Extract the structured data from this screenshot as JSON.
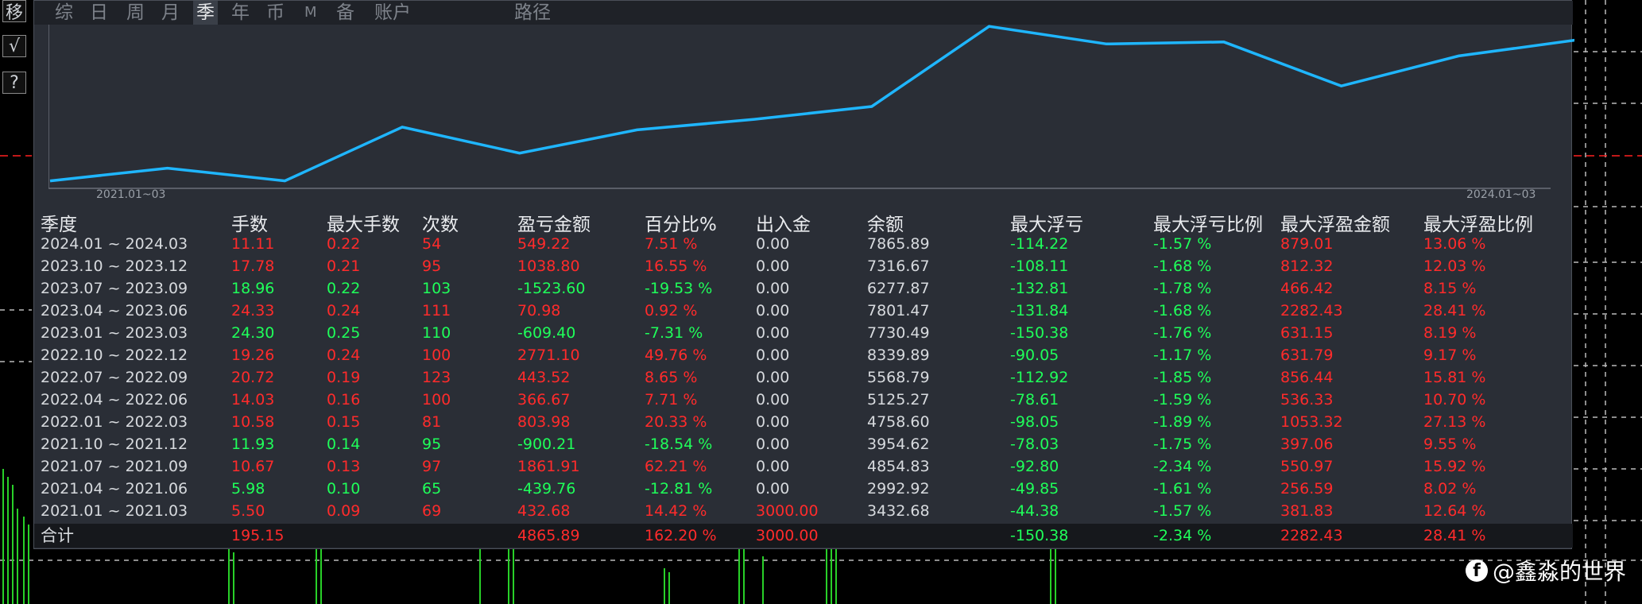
{
  "side_buttons": [
    "移",
    "√",
    "?"
  ],
  "tabs": [
    {
      "label": "综",
      "active": false
    },
    {
      "label": "日",
      "active": false
    },
    {
      "label": "周",
      "active": false
    },
    {
      "label": "月",
      "active": false
    },
    {
      "label": "季",
      "active": true
    },
    {
      "label": "年",
      "active": false
    },
    {
      "label": "币",
      "active": false
    },
    {
      "label": "M",
      "active": false
    },
    {
      "label": "备",
      "active": false
    },
    {
      "label": "账户",
      "active": false
    },
    {
      "label": "路径",
      "active": false
    }
  ],
  "equity_chart": {
    "start_label": "2021.01~03",
    "end_label": "2024.01~03",
    "color": "#1fb6ff",
    "balances": [
      2992.92,
      3432.68,
      2992.92,
      4854.83,
      3954.62,
      4758.6,
      5125.27,
      5568.79,
      8339.89,
      7730.49,
      7801.47,
      6277.87,
      7316.67,
      7865.89
    ]
  },
  "headers": [
    "季度",
    "手数",
    "最大手数",
    "次数",
    "盈亏金额",
    "百分比%",
    "出入金",
    "余额",
    "最大浮亏",
    "最大浮亏比例",
    "最大浮盈金额",
    "最大浮盈比例"
  ],
  "rows": [
    {
      "period": "2024.01 ~ 2024.03",
      "lots": "11.11",
      "max_lots": "0.22",
      "count": "54",
      "pnl": "549.22",
      "pct": "7.51 %",
      "flow": "0.00",
      "balance": "7865.89",
      "max_dd": "-114.22",
      "max_dd_pct": "-1.57 %",
      "max_float": "879.01",
      "max_float_pct": "13.06 %",
      "positive": true
    },
    {
      "period": "2023.10 ~ 2023.12",
      "lots": "17.78",
      "max_lots": "0.21",
      "count": "95",
      "pnl": "1038.80",
      "pct": "16.55 %",
      "flow": "0.00",
      "balance": "7316.67",
      "max_dd": "-108.11",
      "max_dd_pct": "-1.68 %",
      "max_float": "812.32",
      "max_float_pct": "12.03 %",
      "positive": true
    },
    {
      "period": "2023.07 ~ 2023.09",
      "lots": "18.96",
      "max_lots": "0.22",
      "count": "103",
      "pnl": "-1523.60",
      "pct": "-19.53 %",
      "flow": "0.00",
      "balance": "6277.87",
      "max_dd": "-132.81",
      "max_dd_pct": "-1.78 %",
      "max_float": "466.42",
      "max_float_pct": "8.15 %",
      "positive": false
    },
    {
      "period": "2023.04 ~ 2023.06",
      "lots": "24.33",
      "max_lots": "0.24",
      "count": "111",
      "pnl": "70.98",
      "pct": "0.92 %",
      "flow": "0.00",
      "balance": "7801.47",
      "max_dd": "-131.84",
      "max_dd_pct": "-1.68 %",
      "max_float": "2282.43",
      "max_float_pct": "28.41 %",
      "positive": true
    },
    {
      "period": "2023.01 ~ 2023.03",
      "lots": "24.30",
      "max_lots": "0.25",
      "count": "110",
      "pnl": "-609.40",
      "pct": "-7.31 %",
      "flow": "0.00",
      "balance": "7730.49",
      "max_dd": "-150.38",
      "max_dd_pct": "-1.76 %",
      "max_float": "631.15",
      "max_float_pct": "8.19 %",
      "positive": false
    },
    {
      "period": "2022.10 ~ 2022.12",
      "lots": "19.26",
      "max_lots": "0.24",
      "count": "100",
      "pnl": "2771.10",
      "pct": "49.76 %",
      "flow": "0.00",
      "balance": "8339.89",
      "max_dd": "-90.05",
      "max_dd_pct": "-1.17 %",
      "max_float": "631.79",
      "max_float_pct": "9.17 %",
      "positive": true
    },
    {
      "period": "2022.07 ~ 2022.09",
      "lots": "20.72",
      "max_lots": "0.19",
      "count": "123",
      "pnl": "443.52",
      "pct": "8.65 %",
      "flow": "0.00",
      "balance": "5568.79",
      "max_dd": "-112.92",
      "max_dd_pct": "-1.85 %",
      "max_float": "856.44",
      "max_float_pct": "15.81 %",
      "positive": true
    },
    {
      "period": "2022.04 ~ 2022.06",
      "lots": "14.03",
      "max_lots": "0.16",
      "count": "100",
      "pnl": "366.67",
      "pct": "7.71 %",
      "flow": "0.00",
      "balance": "5125.27",
      "max_dd": "-78.61",
      "max_dd_pct": "-1.59 %",
      "max_float": "536.33",
      "max_float_pct": "10.70 %",
      "positive": true
    },
    {
      "period": "2022.01 ~ 2022.03",
      "lots": "10.58",
      "max_lots": "0.15",
      "count": "81",
      "pnl": "803.98",
      "pct": "20.33 %",
      "flow": "0.00",
      "balance": "4758.60",
      "max_dd": "-98.05",
      "max_dd_pct": "-1.89 %",
      "max_float": "1053.32",
      "max_float_pct": "27.13 %",
      "positive": true
    },
    {
      "period": "2021.10 ~ 2021.12",
      "lots": "11.93",
      "max_lots": "0.14",
      "count": "95",
      "pnl": "-900.21",
      "pct": "-18.54 %",
      "flow": "0.00",
      "balance": "3954.62",
      "max_dd": "-78.03",
      "max_dd_pct": "-1.75 %",
      "max_float": "397.06",
      "max_float_pct": "9.55 %",
      "positive": false
    },
    {
      "period": "2021.07 ~ 2021.09",
      "lots": "10.67",
      "max_lots": "0.13",
      "count": "97",
      "pnl": "1861.91",
      "pct": "62.21 %",
      "flow": "0.00",
      "balance": "4854.83",
      "max_dd": "-92.80",
      "max_dd_pct": "-2.34 %",
      "max_float": "550.97",
      "max_float_pct": "15.92 %",
      "positive": true
    },
    {
      "period": "2021.04 ~ 2021.06",
      "lots": "5.98",
      "max_lots": "0.10",
      "count": "65",
      "pnl": "-439.76",
      "pct": "-12.81 %",
      "flow": "0.00",
      "balance": "2992.92",
      "max_dd": "-49.85",
      "max_dd_pct": "-1.61 %",
      "max_float": "256.59",
      "max_float_pct": "8.02 %",
      "positive": false
    },
    {
      "period": "2021.01 ~ 2021.03",
      "lots": "5.50",
      "max_lots": "0.09",
      "count": "69",
      "pnl": "432.68",
      "pct": "14.42 %",
      "flow": "3000.00",
      "balance": "3432.68",
      "max_dd": "-44.38",
      "max_dd_pct": "-1.57 %",
      "max_float": "381.83",
      "max_float_pct": "12.64 %",
      "positive": true
    }
  ],
  "total": {
    "label": "合计",
    "lots": "195.15",
    "pnl": "4865.89",
    "pct": "162.20 %",
    "flow": "3000.00",
    "max_dd": "-150.38",
    "max_dd_pct": "-2.34 %",
    "max_float": "2282.43",
    "max_float_pct": "28.41 %"
  },
  "watermark": "@鑫淼的世界",
  "watermark_icon": "f",
  "colors": {
    "up": "#ff2b2b",
    "down": "#1fff5a",
    "neutral": "#d7dade",
    "accent": "#1fb6ff"
  }
}
